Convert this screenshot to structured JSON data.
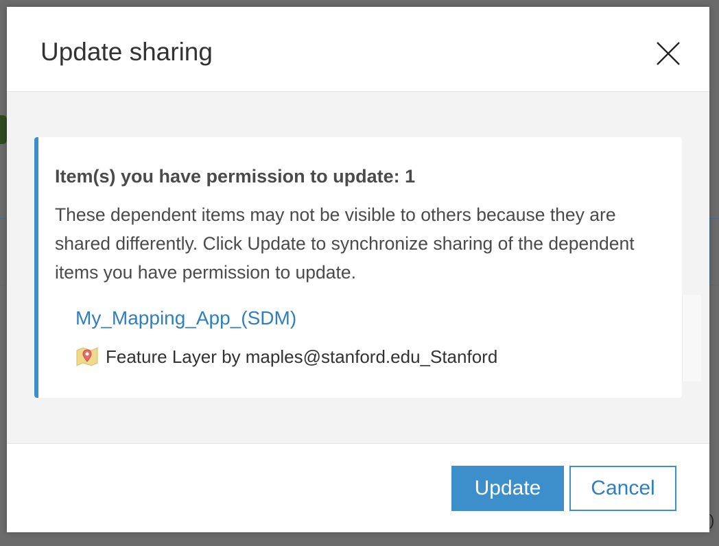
{
  "dialog": {
    "title": "Update sharing",
    "close_icon": "close-icon"
  },
  "notice": {
    "heading": "Item(s) you have permission to update: 1",
    "description": "These dependent items may not be visible to others because they are shared differently. Click Update to synchronize sharing of the dependent items you have permission to update.",
    "accent_color": "#3d8fcb"
  },
  "items": [
    {
      "title": "My_Mapping_App_(SDM)",
      "meta": "Feature Layer by maples@stanford.edu_Stanford",
      "icon": "feature-layer-icon"
    }
  ],
  "footer": {
    "update_label": "Update",
    "cancel_label": "Cancel"
  },
  "colors": {
    "primary": "#3d8fcb",
    "link": "#2f7fc0",
    "text": "#4a4a4a"
  }
}
